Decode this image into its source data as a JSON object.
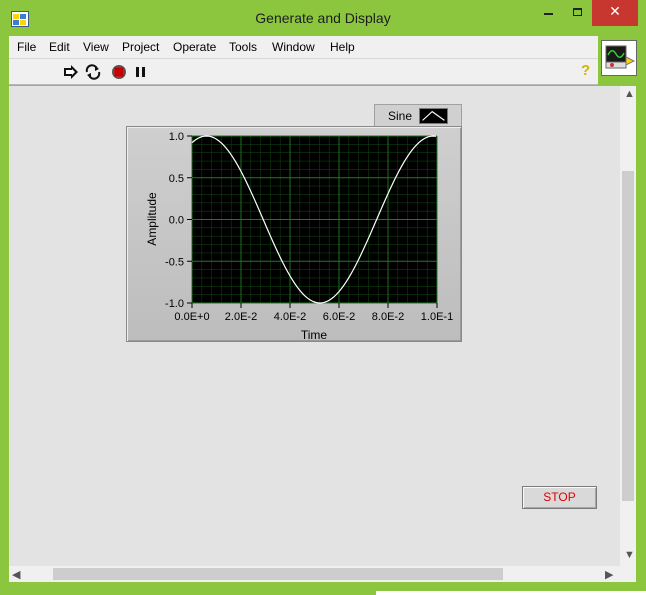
{
  "window": {
    "title": "Generate and Display"
  },
  "menu": {
    "items": [
      "File",
      "Edit",
      "View",
      "Project",
      "Operate",
      "Tools",
      "Window",
      "Help"
    ]
  },
  "toolbar": {
    "icons": [
      "run-arrow-icon",
      "run-continuously-icon",
      "abort-icon",
      "pause-icon"
    ],
    "help_label": "?"
  },
  "legend": {
    "name": "Sine"
  },
  "stop_button": {
    "label": "STOP"
  },
  "colors": {
    "titlebar": "#8cc63e",
    "close": "#c7372f",
    "plot_bg": "#000000",
    "grid": "#1f7a1f",
    "trace": "#ffffff",
    "stop_text": "#e00000"
  },
  "chart_data": {
    "type": "line",
    "title": "",
    "xlabel": "Time",
    "ylabel": "Amplitude",
    "xlim": [
      0,
      0.1
    ],
    "ylim": [
      -1.0,
      1.0
    ],
    "x_ticks": [
      "0.0E+0",
      "2.0E-2",
      "4.0E-2",
      "6.0E-2",
      "8.0E-2",
      "1.0E-1"
    ],
    "y_ticks": [
      "1.0",
      "0.5",
      "0.0",
      "-0.5",
      "-1.0"
    ],
    "grid": true,
    "series": [
      {
        "name": "Sine",
        "color": "#ffffff",
        "function": "sine",
        "frequency_hz": 10.8,
        "phase_deg": 67,
        "x_start": 0,
        "x_end": 0.1,
        "samples": 100
      }
    ]
  }
}
